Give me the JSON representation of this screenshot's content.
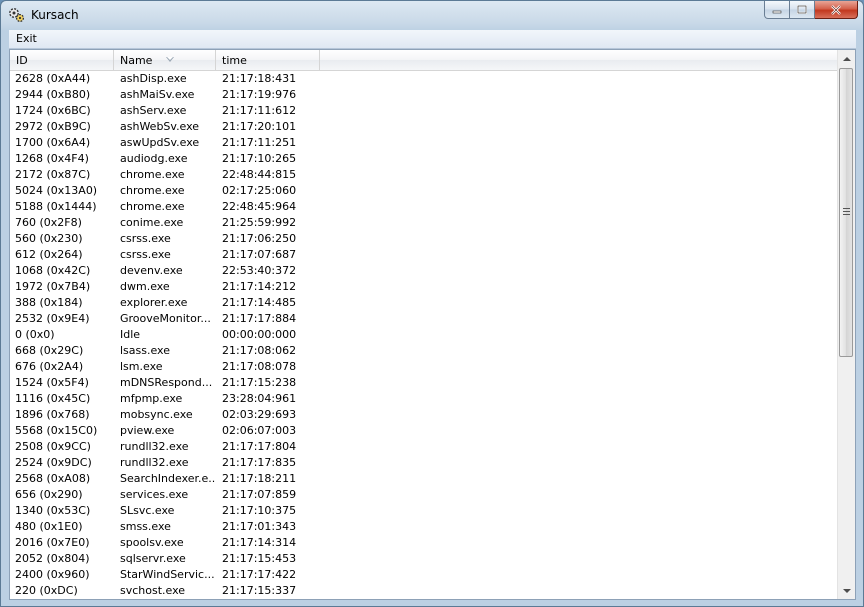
{
  "window": {
    "title": "Kursach"
  },
  "menu": {
    "exit": "Exit"
  },
  "columns": {
    "id": "ID",
    "name": "Name",
    "time": "time"
  },
  "rows": [
    {
      "id": "2628 (0xA44)",
      "name": "ashDisp.exe",
      "time": "21:17:18:431"
    },
    {
      "id": "2944 (0xB80)",
      "name": "ashMaiSv.exe",
      "time": "21:17:19:976"
    },
    {
      "id": "1724 (0x6BC)",
      "name": "ashServ.exe",
      "time": "21:17:11:612"
    },
    {
      "id": "2972 (0xB9C)",
      "name": "ashWebSv.exe",
      "time": "21:17:20:101"
    },
    {
      "id": "1700 (0x6A4)",
      "name": "aswUpdSv.exe",
      "time": "21:17:11:251"
    },
    {
      "id": "1268 (0x4F4)",
      "name": "audiodg.exe",
      "time": "21:17:10:265"
    },
    {
      "id": "2172 (0x87C)",
      "name": "chrome.exe",
      "time": "22:48:44:815"
    },
    {
      "id": "5024 (0x13A0)",
      "name": "chrome.exe",
      "time": "02:17:25:060"
    },
    {
      "id": "5188 (0x1444)",
      "name": "chrome.exe",
      "time": "22:48:45:964"
    },
    {
      "id": "760 (0x2F8)",
      "name": "conime.exe",
      "time": "21:25:59:992"
    },
    {
      "id": "560 (0x230)",
      "name": "csrss.exe",
      "time": "21:17:06:250"
    },
    {
      "id": "612 (0x264)",
      "name": "csrss.exe",
      "time": "21:17:07:687"
    },
    {
      "id": "1068 (0x42C)",
      "name": "devenv.exe",
      "time": "22:53:40:372"
    },
    {
      "id": "1972 (0x7B4)",
      "name": "dwm.exe",
      "time": "21:17:14:212"
    },
    {
      "id": "388 (0x184)",
      "name": "explorer.exe",
      "time": "21:17:14:485"
    },
    {
      "id": "2532 (0x9E4)",
      "name": "GrooveMonitor...",
      "time": "21:17:17:884"
    },
    {
      "id": "0 (0x0)",
      "name": "Idle",
      "time": "00:00:00:000"
    },
    {
      "id": "668 (0x29C)",
      "name": "lsass.exe",
      "time": "21:17:08:062"
    },
    {
      "id": "676 (0x2A4)",
      "name": "lsm.exe",
      "time": "21:17:08:078"
    },
    {
      "id": "1524 (0x5F4)",
      "name": "mDNSRespond...",
      "time": "21:17:15:238"
    },
    {
      "id": "1116 (0x45C)",
      "name": "mfpmp.exe",
      "time": "23:28:04:961"
    },
    {
      "id": "1896 (0x768)",
      "name": "mobsync.exe",
      "time": "02:03:29:693"
    },
    {
      "id": "5568 (0x15C0)",
      "name": "pview.exe",
      "time": "02:06:07:003"
    },
    {
      "id": "2508 (0x9CC)",
      "name": "rundll32.exe",
      "time": "21:17:17:804"
    },
    {
      "id": "2524 (0x9DC)",
      "name": "rundll32.exe",
      "time": "21:17:17:835"
    },
    {
      "id": "2568 (0xA08)",
      "name": "SearchIndexer.e...",
      "time": "21:17:18:211"
    },
    {
      "id": "656 (0x290)",
      "name": "services.exe",
      "time": "21:17:07:859"
    },
    {
      "id": "1340 (0x53C)",
      "name": "SLsvc.exe",
      "time": "21:17:10:375"
    },
    {
      "id": "480 (0x1E0)",
      "name": "smss.exe",
      "time": "21:17:01:343"
    },
    {
      "id": "2016 (0x7E0)",
      "name": "spoolsv.exe",
      "time": "21:17:14:314"
    },
    {
      "id": "2052 (0x804)",
      "name": "sqlservr.exe",
      "time": "21:17:15:453"
    },
    {
      "id": "2400 (0x960)",
      "name": "StarWindServic...",
      "time": "21:17:17:422"
    },
    {
      "id": "220 (0xDC)",
      "name": "svchost.exe",
      "time": "21:17:15:337"
    }
  ]
}
